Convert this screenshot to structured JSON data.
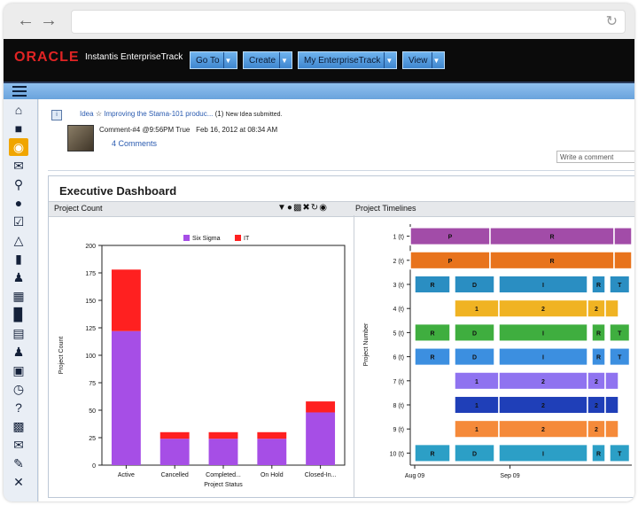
{
  "app": {
    "brand": "ORACLE",
    "product": "Instantis EnterpriseTrack",
    "menu": [
      {
        "label": "Go To"
      },
      {
        "label": "Create"
      },
      {
        "label": "My EnterpriseTrack"
      },
      {
        "label": "View"
      }
    ]
  },
  "feed": {
    "type_label": "Idea",
    "title": "Improving the Stama-101 produc...",
    "count": "(1)",
    "note": "New Idea submitted.",
    "comment_meta": "Comment-#4 @9:56PM True",
    "comment_date": "Feb 16, 2012 at 08:34 AM",
    "comments_link": "4 Comments",
    "comment_placeholder": "Write a comment"
  },
  "dashboard": {
    "title": "Executive Dashboard",
    "left_panel": "Project Count",
    "right_panel": "Project Timelines"
  },
  "chart_data": [
    {
      "type": "bar",
      "stacked": true,
      "categories": [
        "Active",
        "Cancelled",
        "Completed...",
        "On Hold",
        "Closed-In..."
      ],
      "series": [
        {
          "name": "Six Sigma",
          "values": [
            122,
            24,
            24,
            24,
            48
          ],
          "color": "#a64ee6"
        },
        {
          "name": "IT",
          "values": [
            56,
            6,
            6,
            6,
            10
          ],
          "color": "#ff2020"
        }
      ],
      "xlabel": "Project Status",
      "ylabel": "Project Count",
      "ylim": [
        0,
        200
      ],
      "yticks": [
        0,
        25,
        50,
        75,
        100,
        125,
        150,
        175,
        200
      ],
      "legend": "top"
    },
    {
      "type": "gantt",
      "ylabel": "Project Number",
      "xticks": [
        "Aug 09",
        "Sep 09"
      ],
      "rows": [
        {
          "label": "1 (t)",
          "color": "#a24ca8",
          "segments": [
            {
              "start": 0,
              "end": 36,
              "text": "P"
            },
            {
              "start": 36,
              "end": 92,
              "text": "R"
            },
            {
              "start": 92,
              "end": 100,
              "text": ""
            }
          ]
        },
        {
          "label": "2 (t)",
          "color": "#e8731c",
          "segments": [
            {
              "start": 0,
              "end": 36,
              "text": "P"
            },
            {
              "start": 36,
              "end": 92,
              "text": "R"
            },
            {
              "start": 92,
              "end": 100,
              "text": ""
            }
          ]
        },
        {
          "label": "3 (t)",
          "color": "#2a8ec2",
          "segments": [
            {
              "start": 2,
              "end": 18,
              "text": "R"
            },
            {
              "start": 20,
              "end": 38,
              "text": "D"
            },
            {
              "start": 40,
              "end": 80,
              "text": "I"
            },
            {
              "start": 82,
              "end": 88,
              "text": "R"
            },
            {
              "start": 90,
              "end": 99,
              "text": "T"
            }
          ]
        },
        {
          "label": "4 (t)",
          "color": "#f0b323",
          "segments": [
            {
              "start": 20,
              "end": 40,
              "text": "1"
            },
            {
              "start": 40,
              "end": 80,
              "text": "2"
            },
            {
              "start": 80,
              "end": 88,
              "text": "2"
            },
            {
              "start": 88,
              "end": 94,
              "text": ""
            }
          ]
        },
        {
          "label": "5 (t)",
          "color": "#3fae3f",
          "segments": [
            {
              "start": 2,
              "end": 18,
              "text": "R"
            },
            {
              "start": 20,
              "end": 38,
              "text": "D"
            },
            {
              "start": 40,
              "end": 80,
              "text": "I"
            },
            {
              "start": 82,
              "end": 88,
              "text": "R"
            },
            {
              "start": 90,
              "end": 99,
              "text": "T"
            }
          ]
        },
        {
          "label": "6 (t)",
          "color": "#3c8fe0",
          "segments": [
            {
              "start": 2,
              "end": 18,
              "text": "R"
            },
            {
              "start": 20,
              "end": 38,
              "text": "D"
            },
            {
              "start": 40,
              "end": 80,
              "text": "I"
            },
            {
              "start": 82,
              "end": 88,
              "text": "R"
            },
            {
              "start": 90,
              "end": 99,
              "text": "T"
            }
          ]
        },
        {
          "label": "7 (t)",
          "color": "#8f73f0",
          "segments": [
            {
              "start": 20,
              "end": 40,
              "text": "1"
            },
            {
              "start": 40,
              "end": 80,
              "text": "2"
            },
            {
              "start": 80,
              "end": 88,
              "text": "2"
            },
            {
              "start": 88,
              "end": 94,
              "text": ""
            }
          ]
        },
        {
          "label": "8 (t)",
          "color": "#1f3fb8",
          "segments": [
            {
              "start": 20,
              "end": 40,
              "text": "1"
            },
            {
              "start": 40,
              "end": 80,
              "text": "2"
            },
            {
              "start": 80,
              "end": 88,
              "text": "2"
            },
            {
              "start": 88,
              "end": 94,
              "text": ""
            }
          ]
        },
        {
          "label": "9 (t)",
          "color": "#f58a3a",
          "segments": [
            {
              "start": 20,
              "end": 40,
              "text": "1"
            },
            {
              "start": 40,
              "end": 80,
              "text": "2"
            },
            {
              "start": 80,
              "end": 88,
              "text": "2"
            },
            {
              "start": 88,
              "end": 94,
              "text": ""
            }
          ]
        },
        {
          "label": "10 (t)",
          "color": "#2c9fc6",
          "segments": [
            {
              "start": 2,
              "end": 18,
              "text": "R"
            },
            {
              "start": 20,
              "end": 38,
              "text": "D"
            },
            {
              "start": 40,
              "end": 80,
              "text": "I"
            },
            {
              "start": 82,
              "end": 88,
              "text": "R"
            },
            {
              "start": 90,
              "end": 99,
              "text": "T"
            }
          ]
        }
      ]
    }
  ],
  "sidebar_icons": [
    "home-icon",
    "briefcase-icon",
    "globe-icon",
    "mail-icon",
    "key-icon",
    "lightbulb-icon",
    "checkbox-icon",
    "network-icon",
    "folder-icon",
    "person-icon",
    "calendar-icon",
    "bar-chart-icon",
    "book-icon",
    "people-icon",
    "chat-icon",
    "clock-icon",
    "help-icon",
    "document-icon",
    "mail-icon",
    "edit-icon",
    "tools-icon"
  ],
  "icons": {
    "back": "back-arrow-icon",
    "forward": "forward-arrow-icon",
    "reload": "reload-icon"
  }
}
